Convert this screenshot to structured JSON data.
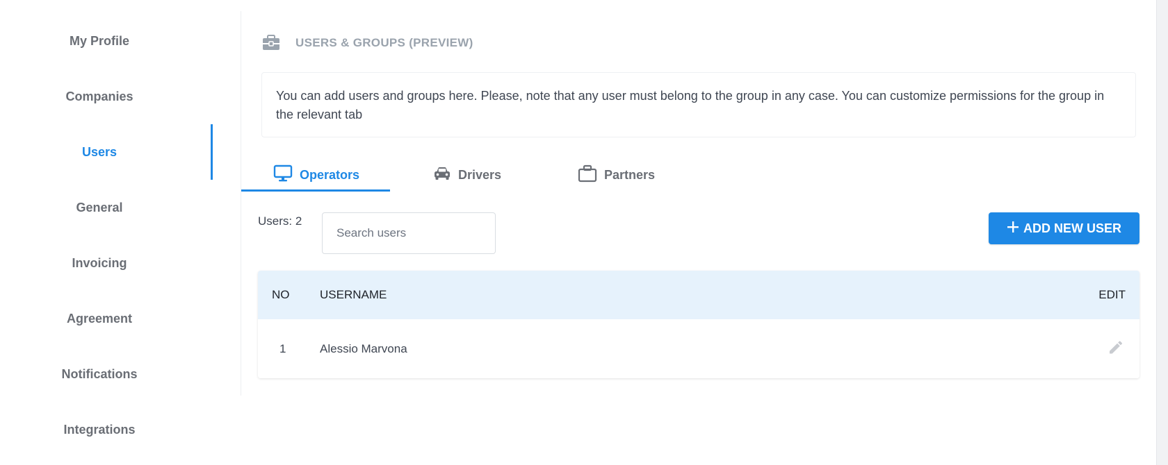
{
  "sidebar": {
    "items": [
      {
        "label": "My Profile"
      },
      {
        "label": "Companies"
      },
      {
        "label": "Users"
      },
      {
        "label": "General"
      },
      {
        "label": "Invoicing"
      },
      {
        "label": "Agreement"
      },
      {
        "label": "Notifications"
      },
      {
        "label": "Integrations"
      }
    ],
    "active": "Users"
  },
  "header": {
    "title": "USERS & GROUPS (PREVIEW)",
    "icon": "toolbox-icon"
  },
  "info": {
    "text": "You can add users and groups here. Please, note that any user must belong to the group in any case. You can customize permissions for the group in the relevant tab"
  },
  "tabs": [
    {
      "label": "Operators",
      "icon": "monitor-icon",
      "active": true
    },
    {
      "label": "Drivers",
      "icon": "car-icon",
      "active": false
    },
    {
      "label": "Partners",
      "icon": "briefcase-icon",
      "active": false
    }
  ],
  "toolbar": {
    "users_count": "Users: 2",
    "search_placeholder": "Search users",
    "add_label": "ADD NEW USER"
  },
  "table": {
    "columns": {
      "no": "NO",
      "username": "USERNAME",
      "edit": "EDIT"
    },
    "rows": [
      {
        "no": "1",
        "username": "Alessio Marvona"
      }
    ]
  },
  "colors": {
    "accent": "#1e88e5",
    "header_bg": "#e6f2fc",
    "muted": "#9aa3ad"
  }
}
